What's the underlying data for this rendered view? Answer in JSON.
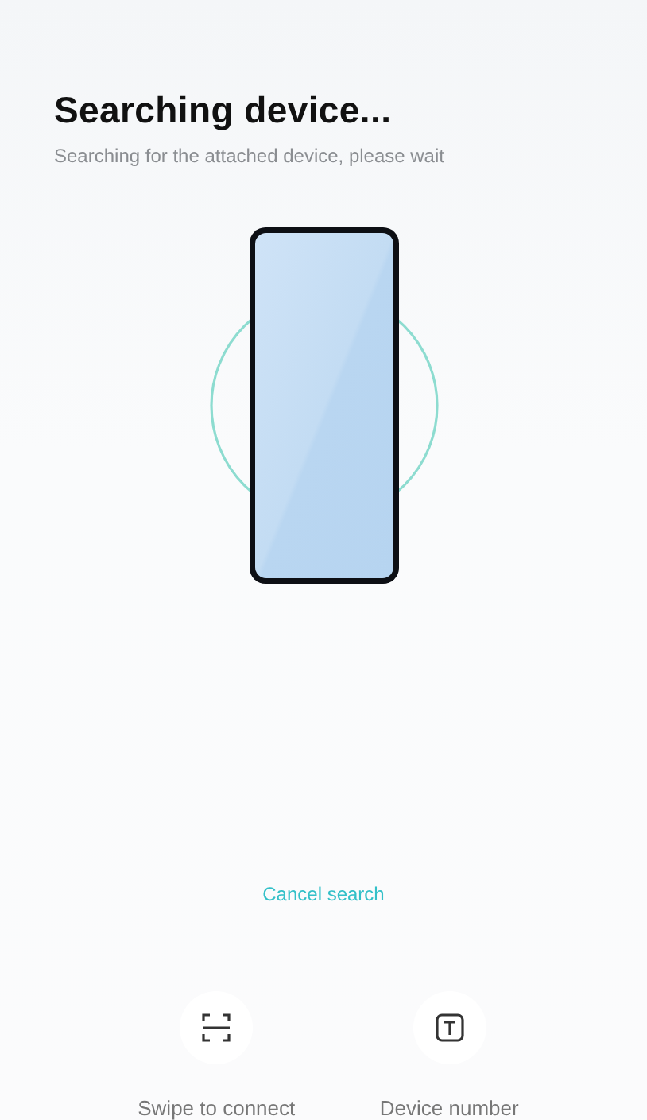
{
  "header": {
    "title": "Searching device...",
    "subtitle": "Searching for the attached device, please wait"
  },
  "cancel": {
    "label": "Cancel search"
  },
  "actions": [
    {
      "kind": "scan",
      "label": "Swipe to connect"
    },
    {
      "kind": "text",
      "label": "Device number"
    }
  ]
}
